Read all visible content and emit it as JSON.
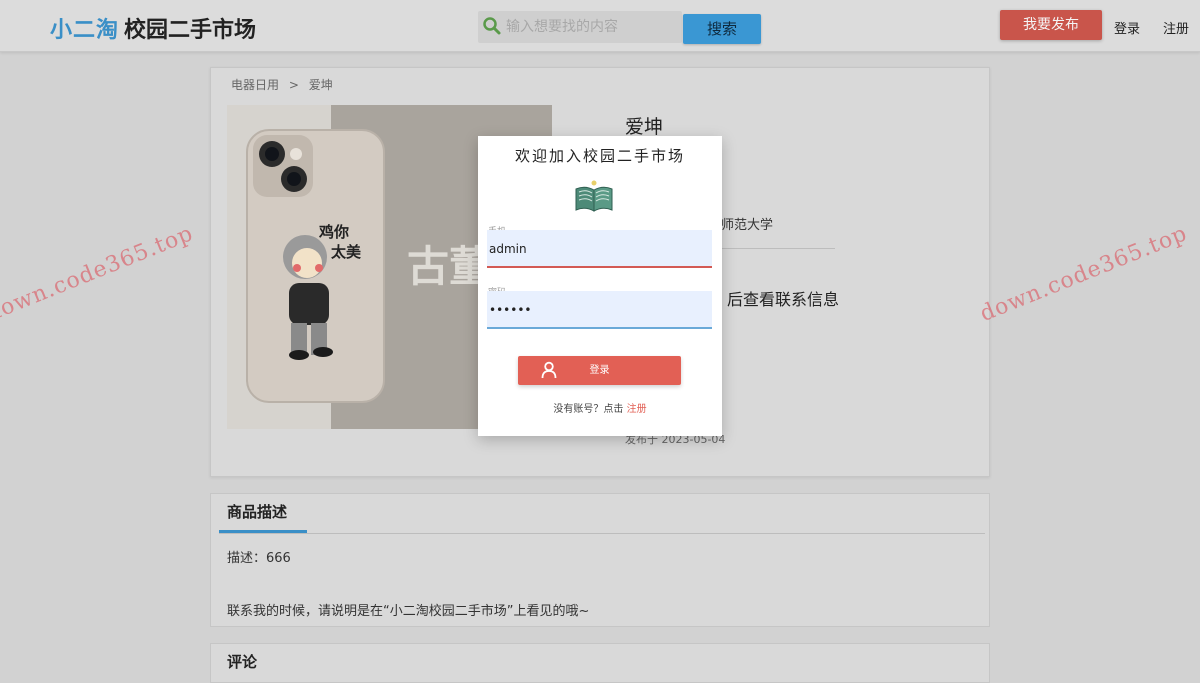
{
  "header": {
    "logo": "小二淘",
    "title": "校园二手市场",
    "search": {
      "placeholder": "输入想要找的内容",
      "button": "搜索"
    },
    "publish_button": "我要发布",
    "login": "登录",
    "register": "注册"
  },
  "product": {
    "breadcrumb": [
      "电器日用",
      ">",
      "爱坤"
    ],
    "name": "爱坤",
    "school": "师范大学",
    "contact_hint": "后查看联系信息",
    "publish_date": "发布于 2023-05-04",
    "image_texts": {
      "sticker": "鸡你太美",
      "partial": "古董"
    }
  },
  "description": {
    "tab": "商品描述",
    "text": "描述：666",
    "contact_note": "联系我的时候，请说明是在“小二淘校园二手市场”上看见的哦~"
  },
  "comments": {
    "title": "评论"
  },
  "login_modal": {
    "title": "欢迎加入校园二手市场",
    "phone_label": "手机",
    "phone_value": "admin",
    "password_label": "密码",
    "password_value": "••••••",
    "login_button": "登录",
    "no_account_prefix": "没有账号？点击",
    "register_link": "注册"
  },
  "watermark": "down.code365.top",
  "colors": {
    "brand_blue": "#3a8fc7",
    "search_button": "#3a97d3",
    "publish_button": "#c9554b",
    "login_button": "#e26055",
    "input_fill": "#e8f0fe"
  }
}
